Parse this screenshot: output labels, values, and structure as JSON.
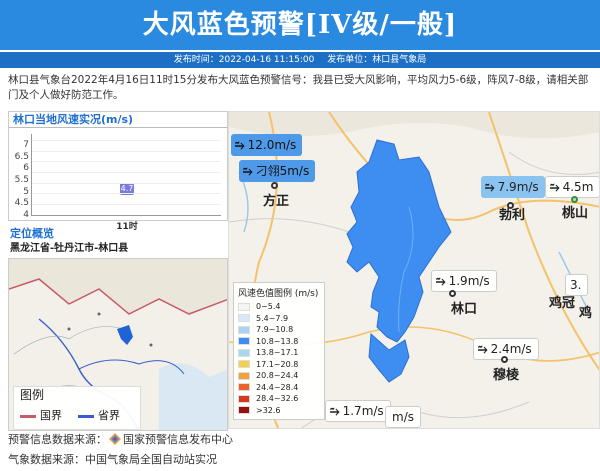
{
  "header": {
    "title": "大风蓝色预警[IV级/一般]",
    "publish_time_label": "发布时间：2022-04-16 11:15:00",
    "publisher_label": "发布单位：林口县气象局"
  },
  "description": "林口县气象台2022年4月16日11时15分发布大风蓝色预警信号：我县已受大风影响，平均风力5-6级，阵风7-8级，请相关部门及个人做好防范工作。",
  "wind_chart": {
    "title": "林口当地风速实况(m/s)",
    "y_ticks": [
      "7",
      "6.5",
      "6",
      "5.5",
      "5",
      "4.5",
      "4"
    ],
    "x_tick": "11时",
    "value_label": "4.7"
  },
  "chart_data": {
    "type": "bar",
    "title": "林口当地风速实况(m/s)",
    "categories": [
      "11时"
    ],
    "values": [
      4.7
    ],
    "ylim": [
      4,
      7
    ],
    "xlabel": "",
    "ylabel": ""
  },
  "location": {
    "title": "定位概览",
    "path": "黑龙江省-牡丹江市-林口县",
    "legend_title": "图例",
    "legend_items": [
      {
        "label": "国界",
        "color": "#c85a6a"
      },
      {
        "label": "省界",
        "color": "#3a5ccf"
      }
    ]
  },
  "map": {
    "stations": [
      {
        "label": "12.0m/s",
        "style": "blue-dark"
      },
      {
        "label": "刁翎5m/s",
        "style": "blue-dark"
      },
      {
        "label": "7.9m/s",
        "style": "blue"
      },
      {
        "label": "4.5m",
        "style": "white"
      },
      {
        "label": "1.9m/s",
        "style": "white"
      },
      {
        "label": "2.4m/s",
        "style": "white"
      },
      {
        "label": "1.7m/s",
        "style": "white"
      },
      {
        "label": "m/s",
        "style": "white"
      },
      {
        "label": "3.",
        "style": "white"
      }
    ],
    "places": [
      "方正",
      "勃利",
      "桃山",
      "林口",
      "鸡冠",
      "鸡",
      "穆棱"
    ],
    "scale_title": "风速色值图例 (m/s)",
    "scale": [
      {
        "label": "0~5.4",
        "color": "#f5f5f5"
      },
      {
        "label": "5.4~7.9",
        "color": "#d8e8f8"
      },
      {
        "label": "7.9~10.8",
        "color": "#a9d3f5"
      },
      {
        "label": "10.8~13.8",
        "color": "#3d8ef0"
      },
      {
        "label": "13.8~17.1",
        "color": "#a8d8f0"
      },
      {
        "label": "17.1~20.8",
        "color": "#f7d04a"
      },
      {
        "label": "20.8~24.4",
        "color": "#f0a23a"
      },
      {
        "label": "24.4~28.4",
        "color": "#e8642a"
      },
      {
        "label": "28.4~32.6",
        "color": "#d43a1e"
      },
      {
        "label": ">32.6",
        "color": "#9a1010"
      }
    ]
  },
  "footer": {
    "warning_source": "预警信息数据来源：",
    "warning_source_org": "国家预警信息发布中心",
    "weather_source": "气象数据来源：中国气象局全国自动站实况"
  }
}
